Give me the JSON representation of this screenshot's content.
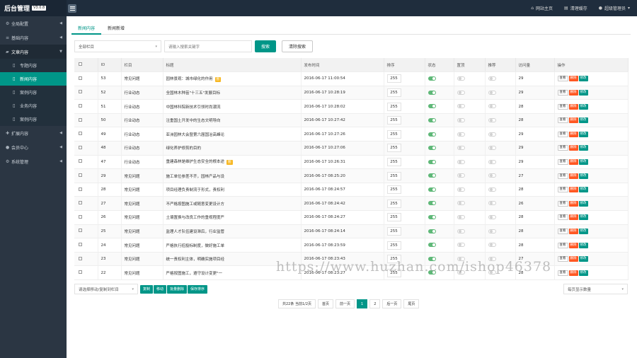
{
  "app": {
    "title": "后台管理",
    "version": "V3.0.8"
  },
  "topnav": {
    "site_home": "网站主页",
    "clear_cache": "清理缓存",
    "user": "超级管理员"
  },
  "sidebar": {
    "items": [
      {
        "label": "全局配置"
      },
      {
        "label": "基础内容"
      },
      {
        "label": "文章内容"
      },
      {
        "label": "扩展内容"
      },
      {
        "label": "会员中心"
      },
      {
        "label": "系统管理"
      }
    ],
    "sub": [
      {
        "label": "专题内容"
      },
      {
        "label": "新闻内容"
      },
      {
        "label": "案例内容"
      },
      {
        "label": "业务内容"
      },
      {
        "label": "案例内容"
      }
    ]
  },
  "tabs": [
    {
      "label": "新闻内容"
    },
    {
      "label": "新闻新增"
    }
  ],
  "filters": {
    "column_select": "全部栏目",
    "search_placeholder": "请输入搜索关键字",
    "search_button": "搜索",
    "clear_button": "清除搜索"
  },
  "table": {
    "headers": [
      "",
      "ID",
      "栏目",
      "标题",
      "发布时间",
      "排序",
      "状态",
      "置顶",
      "推荐",
      "访问量",
      "操作"
    ],
    "rows": [
      {
        "id": "53",
        "column": "常见问题",
        "title": "园林景观：城市绿化的作用",
        "hot": "图",
        "time": "2016-06-17 11:00:54",
        "sort": "255",
        "status": true,
        "top": false,
        "rec": false,
        "visits": "29"
      },
      {
        "id": "52",
        "column": "行业动态",
        "title": "全国林木种苗\"十三五\"发展目标",
        "hot": "",
        "time": "2016-06-17 10:28:19",
        "sort": "255",
        "status": true,
        "top": false,
        "rec": false,
        "visits": "29"
      },
      {
        "id": "51",
        "column": "行业动态",
        "title": "中国林科院新技术引领时尚潮流",
        "hot": "",
        "time": "2016-06-17 10:28:02",
        "sort": "255",
        "status": true,
        "top": false,
        "rec": false,
        "visits": "28"
      },
      {
        "id": "50",
        "column": "行业动态",
        "title": "注重国土开发中的生态文明导向",
        "hot": "",
        "time": "2016-06-17 10:27:42",
        "sort": "255",
        "status": true,
        "top": false,
        "rec": false,
        "visits": "28"
      },
      {
        "id": "49",
        "column": "行业动态",
        "title": "亚洲园林大会暨第六届国冶高峰论",
        "hot": "",
        "time": "2016-06-17 10:27:26",
        "sort": "255",
        "status": true,
        "top": false,
        "rec": false,
        "visits": "29"
      },
      {
        "id": "48",
        "column": "行业动态",
        "title": "绿化养护修剪的目的",
        "hot": "",
        "time": "2016-06-17 10:27:06",
        "sort": "255",
        "status": true,
        "top": false,
        "rec": false,
        "visits": "29"
      },
      {
        "id": "47",
        "column": "行业动态",
        "title": "重建森林是维护生态安全的根本途",
        "hot": "图",
        "time": "2016-06-17 10:26:31",
        "sort": "255",
        "status": true,
        "top": false,
        "rec": false,
        "visits": "29"
      },
      {
        "id": "29",
        "column": "常见问题",
        "title": "施工单位参差不齐，园林产品与设",
        "hot": "",
        "time": "2016-06-17 08:25:20",
        "sort": "255",
        "status": true,
        "top": false,
        "rec": false,
        "visits": "27"
      },
      {
        "id": "28",
        "column": "常见问题",
        "title": "项目经理负责制流于形式，责权利",
        "hot": "",
        "time": "2016-06-17 08:24:57",
        "sort": "255",
        "status": true,
        "top": false,
        "rec": false,
        "visits": "28"
      },
      {
        "id": "27",
        "column": "常见问题",
        "title": "不严格按图施工或随意变更设计方",
        "hot": "",
        "time": "2016-06-17 08:24:42",
        "sort": "255",
        "status": true,
        "top": false,
        "rec": false,
        "visits": "26"
      },
      {
        "id": "26",
        "column": "常见问题",
        "title": "土壤置换与改良工作的重视程度严",
        "hot": "",
        "time": "2016-06-17 08:24:27",
        "sort": "255",
        "status": true,
        "top": false,
        "rec": false,
        "visits": "28"
      },
      {
        "id": "25",
        "column": "常见问题",
        "title": "监理人才队伍建设滞后，行业监管",
        "hot": "",
        "time": "2016-06-17 08:24:14",
        "sort": "255",
        "status": true,
        "top": false,
        "rec": false,
        "visits": "28"
      },
      {
        "id": "24",
        "column": "常见问题",
        "title": "严格执行招投标制度，做好施工单",
        "hot": "",
        "time": "2016-06-17 08:23:59",
        "sort": "255",
        "status": true,
        "top": false,
        "rec": false,
        "visits": "28"
      },
      {
        "id": "23",
        "column": "常见问题",
        "title": "统一责权利主体，明确实施项目经",
        "hot": "",
        "time": "2016-06-17 08:23:43",
        "sort": "255",
        "status": true,
        "top": false,
        "rec": false,
        "visits": "27"
      },
      {
        "id": "22",
        "column": "常见问题",
        "title": "严格按图施工，遵守设计变更\"一",
        "hot": "",
        "time": "2016-06-17 08:23:27",
        "sort": "255",
        "status": true,
        "top": false,
        "rec": false,
        "visits": "28"
      }
    ],
    "ops": {
      "view": "查看",
      "delete": "删除",
      "edit": "修改"
    }
  },
  "bulk": {
    "move_select": "请选择移动/复制到栏目",
    "copy": "复制",
    "move": "移动",
    "batch_delete": "批量删除",
    "save_sort": "保存排序",
    "per_page": "每页显示数量"
  },
  "pager": {
    "summary": "共22条 当前1/2页",
    "first": "首页",
    "prev": "前一页",
    "page1": "1",
    "page2": "2",
    "next": "后一页",
    "last": "尾页"
  },
  "watermark": "https://www.huzhan.com/ishop46378",
  "colors": {
    "accent": "#009688",
    "danger": "#ff5722",
    "sidebar": "#2b3643",
    "topbar": "#1f2d3d"
  }
}
